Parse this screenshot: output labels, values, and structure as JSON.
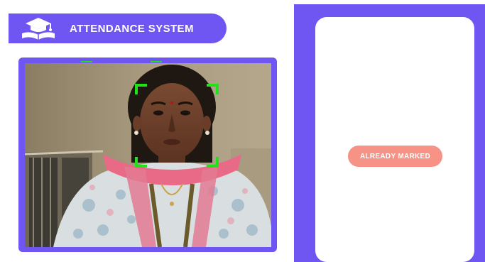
{
  "app": {
    "title": "ATTENDANCE SYSTEM",
    "logo_icon": "graduation-book-icon"
  },
  "camera": {
    "face_frame_color": "#22e01a"
  },
  "status": {
    "label": "ALREADY MARKED"
  },
  "colors": {
    "accent": "#6f55f2",
    "status_pill": "#f79286",
    "face_box": "#22e01a",
    "card": "#ffffff"
  }
}
